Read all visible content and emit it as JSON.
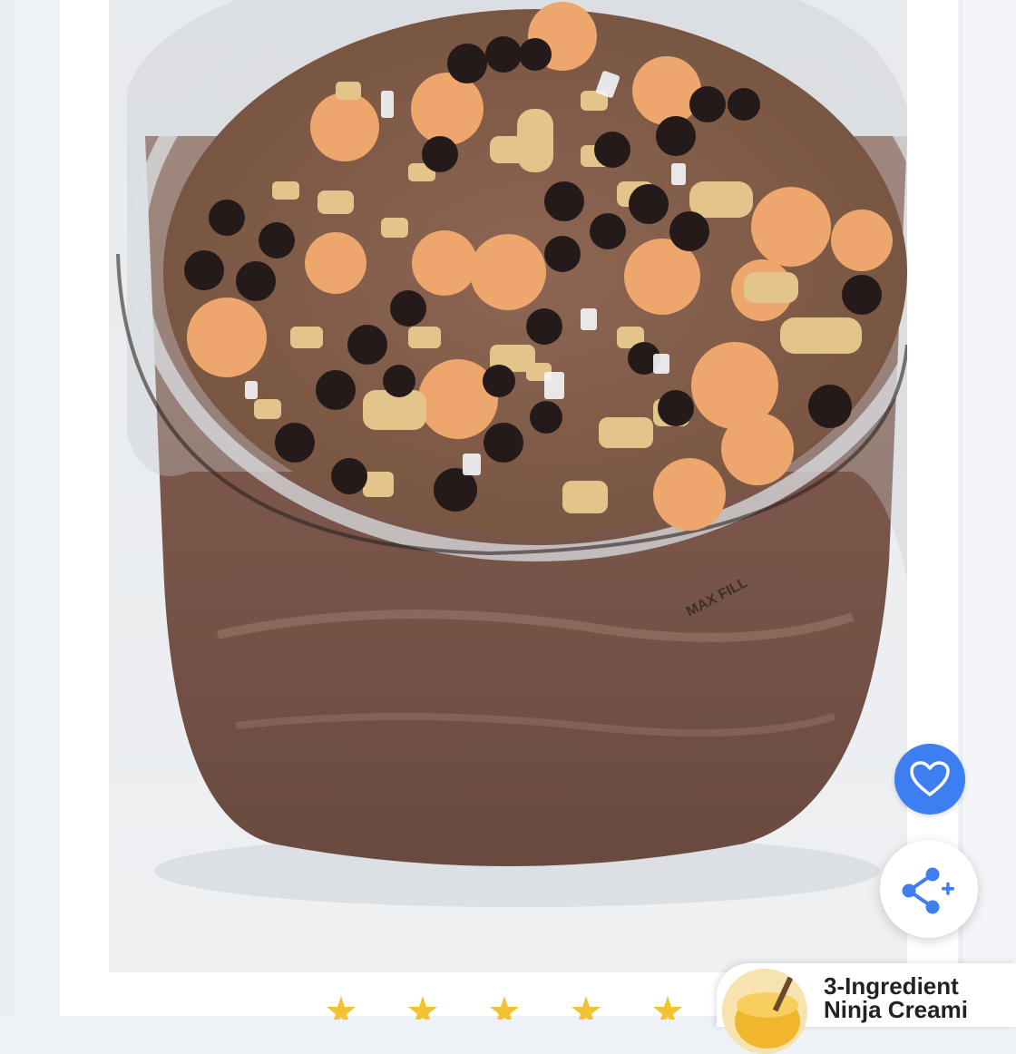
{
  "photo": {
    "jar_label": "MAX FILL"
  },
  "actions": {
    "favorite_icon": "heart-icon",
    "share_icon": "share-plus-icon",
    "favorite_color": "#3d7ff0"
  },
  "rating": {
    "star_color": "#f2c233",
    "stars_visible": 5
  },
  "related_recipe": {
    "title": "3-Ingredient Ninja Creami"
  }
}
